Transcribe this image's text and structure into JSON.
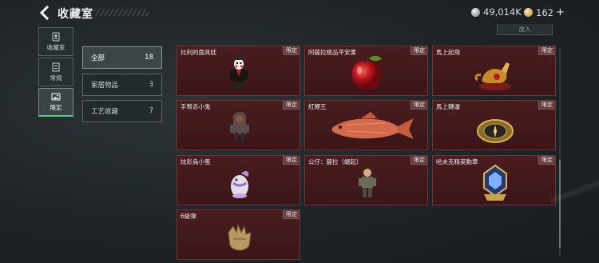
{
  "header": {
    "title": "收藏室",
    "currency_silver": "49,014K",
    "currency_gold": "162",
    "plus": "+"
  },
  "side_tabs": [
    {
      "label": "收藏室",
      "icon": "id-card-icon",
      "active": false
    },
    {
      "label": "常规",
      "icon": "document-icon",
      "active": false
    },
    {
      "label": "限定",
      "icon": "picture-icon",
      "active": true
    }
  ],
  "filters": [
    {
      "label": "全部",
      "count": "18",
      "active": true
    },
    {
      "label": "家居物品",
      "count": "3",
      "active": false
    },
    {
      "label": "工艺收藏",
      "count": "7",
      "active": false
    }
  ],
  "top_button": "放入",
  "items": [
    {
      "name": "比利的面具娃",
      "tag": "限定",
      "icon": "billy-puppet-icon"
    },
    {
      "name": "阿薩拉極品平安果",
      "tag": "限定",
      "icon": "red-apple-icon"
    },
    {
      "name": "馬上起飛",
      "tag": "限定",
      "icon": "golden-horse-icon"
    },
    {
      "name": "手臂赤小鬼",
      "tag": "限定",
      "icon": "hooded-figure-icon"
    },
    {
      "name": "紅鯉王",
      "tag": "限定",
      "icon": "red-carp-icon"
    },
    {
      "name": "馬上轉運",
      "tag": "限定",
      "icon": "compass-medallion-icon"
    },
    {
      "name": "炫彩烏小蛋",
      "tag": "限定",
      "icon": "egg-bird-icon"
    },
    {
      "name": "公仔：薩拉（崛起）",
      "tag": "限定",
      "icon": "soldier-figure-icon"
    },
    {
      "name": "哈夫克精英勳章",
      "tag": "限定",
      "icon": "elite-medal-icon"
    },
    {
      "name": "6級彈",
      "tag": "限定",
      "icon": "gold-glove-icon"
    }
  ]
}
